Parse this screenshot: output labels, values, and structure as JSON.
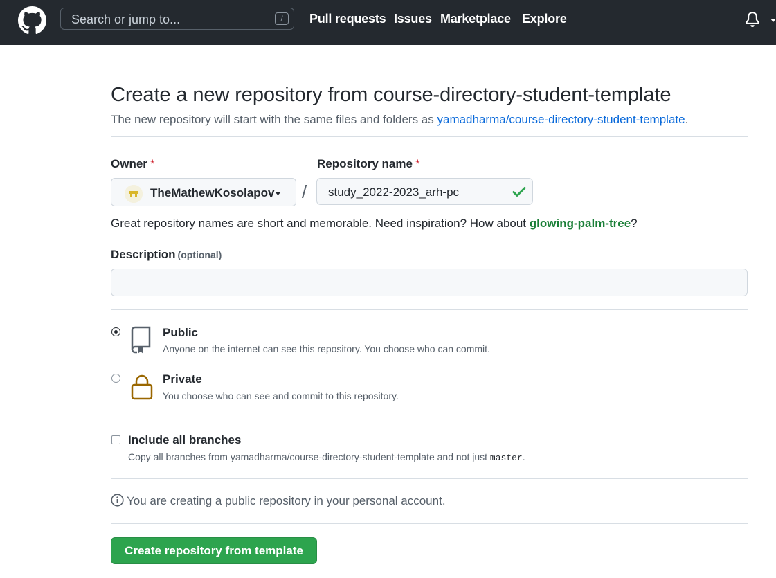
{
  "header": {
    "search_placeholder": "Search or jump to...",
    "search_shortcut": "/",
    "nav": [
      "Pull requests",
      "Issues",
      "Marketplace",
      "Explore"
    ]
  },
  "page": {
    "title": "Create a new repository from course-directory-student-template",
    "subtitle_prefix": "The new repository will start with the same files and folders as ",
    "template_link": "yamadharma/course-directory-student-template",
    "subtitle_suffix": "."
  },
  "form": {
    "owner_label": "Owner",
    "required_mark": "*",
    "owner_value": "TheMathewKosolapov",
    "separator": "/",
    "repo_label": "Repository name",
    "repo_value": "study_2022-2023_arh-pc",
    "hint_prefix": "Great repository names are short and memorable. Need inspiration? How about ",
    "hint_suggestion": "glowing-palm-tree",
    "hint_suffix": "?",
    "description_label": "Description",
    "description_optional": "(optional)",
    "description_value": ""
  },
  "visibility": {
    "public_title": "Public",
    "public_desc": "Anyone on the internet can see this repository. You choose who can commit.",
    "private_title": "Private",
    "private_desc": "You choose who can see and commit to this repository.",
    "selected": "Public"
  },
  "branches": {
    "title": "Include all branches",
    "desc_prefix": "Copy all branches from yamadharma/course-directory-student-template and not just ",
    "desc_code": "master",
    "desc_suffix": ".",
    "checked": false
  },
  "info_text": "You are creating a public repository in your personal account.",
  "submit_label": "Create repository from template",
  "colors": {
    "header_bg": "#24292f",
    "link": "#0969da",
    "success": "#2da44e",
    "required": "#cf222e",
    "private_lock": "#9a6700"
  },
  "icons": [
    "github-logo-icon",
    "bell-icon",
    "chevron-down-icon",
    "check-icon",
    "repo-icon",
    "lock-icon",
    "info-icon"
  ]
}
